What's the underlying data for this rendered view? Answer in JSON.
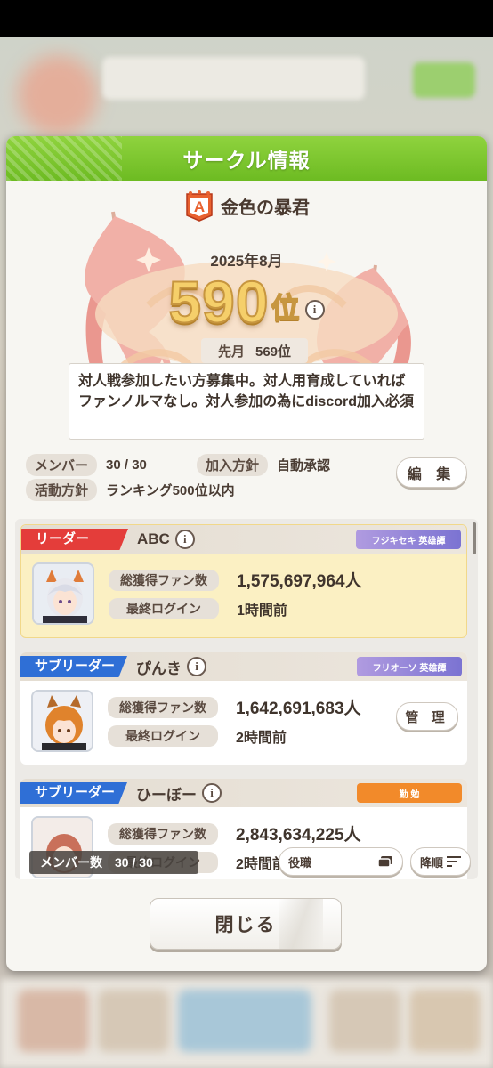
{
  "dialog": {
    "title": "サークル情報",
    "circle_name": "金色の暴君",
    "rank_badge_letter": "A",
    "month": "2025年8月",
    "rank": "590",
    "rank_unit": "位",
    "info_glyph": "i",
    "prev_label": "先月",
    "prev_rank": "569位",
    "description": "対人戦参加したい方募集中。対人用育成していればファンノルマなし。対人参加の為にdiscord加入必須",
    "members_label": "メンバー",
    "members_value": "30 / 30",
    "join_label": "加入方針",
    "join_value": "自動承認",
    "policy_label": "活動方針",
    "policy_value": "ランキング500位以内",
    "edit_label": "編 集",
    "close_label": "閉じる"
  },
  "members": [
    {
      "role": "リーダー",
      "name": "ABC",
      "badge": "フジキセキ 英雄譚",
      "fans_label": "総獲得ファン数",
      "fans": "1,575,697,964人",
      "login_label": "最終ログイン",
      "login": "1時間前"
    },
    {
      "role": "サブリーダー",
      "name": "ぴんき",
      "badge": "フリオーソ 英雄譚",
      "fans_label": "総獲得ファン数",
      "fans": "1,642,691,683人",
      "login_label": "最終ログイン",
      "login": "2時間前",
      "manage_label": "管 理"
    },
    {
      "role": "サブリーダー",
      "name": "ひーぼー",
      "badge": "勤 勉",
      "fans_label": "総獲得ファン数",
      "fans": "2,843,634,225人",
      "login_label": "最終ログイン",
      "login": "2時間前"
    }
  ],
  "list_footer": {
    "count_label": "メンバー数",
    "count_value": "30 / 30",
    "sort_role": "役職",
    "sort_order": "降順"
  },
  "colors": {
    "header_green": "#7cc62e",
    "leader_red": "#e43d3a",
    "subleader_blue": "#2f6fd6",
    "rank_gold": "#f5cf6a"
  }
}
